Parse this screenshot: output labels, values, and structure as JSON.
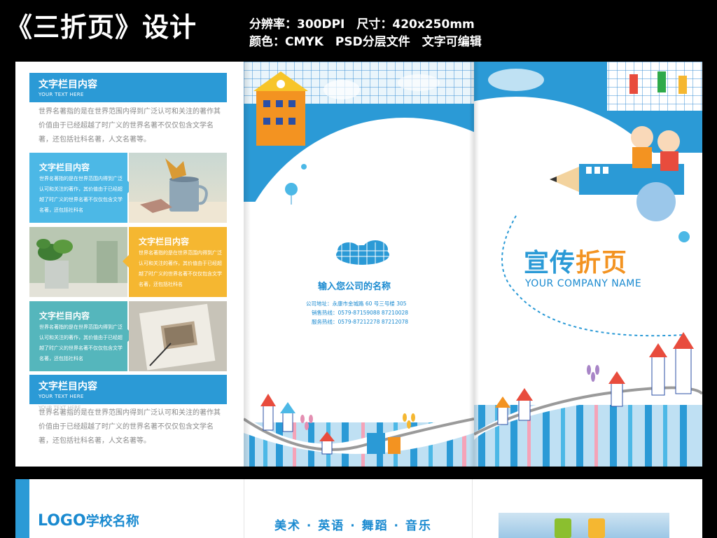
{
  "header": {
    "title": "《三折页》设计",
    "specs_line1": "分辨率：300DPI　尺寸：420x250mm",
    "specs_line2": "颜色：CMYK　PSD分层文件　文字可编辑"
  },
  "left_panel": {
    "section1": {
      "title": "文字栏目内容",
      "subtitle": "YOUR TEXT HERE",
      "body": "世界名著指的是在世界范围内得到广泛认可和关注的著作其价值由于已经超越了时广义的世界名著不仅仅包含文学名著，还包括社科名著，人文名著等。"
    },
    "row1": {
      "title": "文字栏目内容",
      "body": "世界名著指的是在世界范围内得到广泛认可和关注的著作，其价值由于已经超越了时广义的世界名著不仅仅包含文学名著，还包括社科名"
    },
    "row2": {
      "title": "文字栏目内容",
      "body": "世界名著指的是在世界范围内得到广泛认可和关注的著作，其价值由于已经超越了时广义的世界名著不仅仅包含文学名著，还包括社科名"
    },
    "row3": {
      "title": "文字栏目内容",
      "body": "世界名著指的是在世界范围内得到广泛认可和关注的著作，其价值由于已经超越了时广义的世界名著不仅仅包含文学名著，还包括社科名"
    },
    "section2": {
      "title": "文字栏目内容",
      "subtitle": "YOUR TEXT HERE",
      "watermark": "YOUR TEXT HERE",
      "body": "世界名著指的是在世界范围内得到广泛认可和关注的著作其价值由于已经超越了时广义的世界名著不仅仅包含文学名著，还包括社科名著，人文名著等。"
    }
  },
  "middle_panel": {
    "company_name": "输入您公司的名称",
    "address": "公司地址：永康市金城路 60 号三号楼 305",
    "sales_hotline": "销售热线：0579-87159088 87210028",
    "service_hotline": "服务热线：0579-87212278 87212078"
  },
  "right_panel": {
    "brand_title": "宣传折页",
    "brand_en": "YOUR COMPANY NAME"
  },
  "bottom": {
    "logo": "LOGO",
    "school_name": "学校名称",
    "subjects": "美术 · 英语 · 舞蹈 · 音乐"
  },
  "colors": {
    "blue": "#2b9ad6",
    "cyan": "#4cb8e6",
    "yellow": "#f5b731",
    "teal": "#55b6bc",
    "red": "#e84c3d",
    "orange": "#f39321",
    "green": "#2eaa4a"
  }
}
